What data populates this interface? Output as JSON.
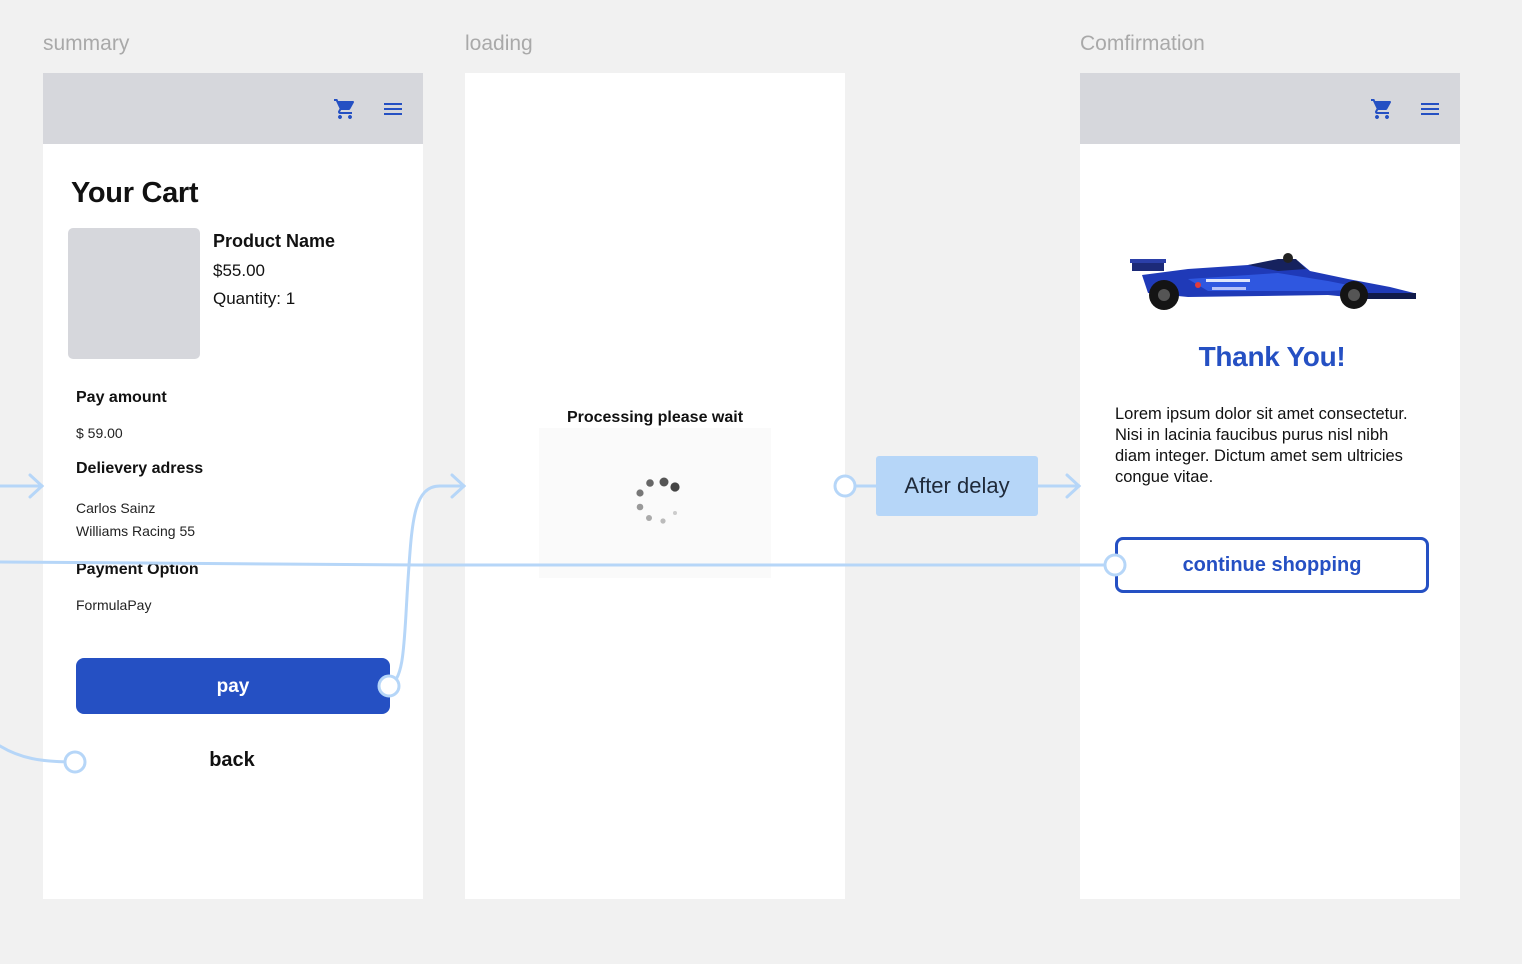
{
  "frames": {
    "summary_label": "summary",
    "loading_label": "loading",
    "confirmation_label": "Comfirmation"
  },
  "summary": {
    "title": "Your Cart",
    "product": {
      "name": "Product Name",
      "price": "$55.00",
      "quantity": "Quantity: 1"
    },
    "pay_amount_heading": "Pay amount",
    "pay_amount_value": "$ 59.00",
    "delivery_heading": "Delievery adress",
    "delivery_line1": "Carlos Sainz",
    "delivery_line2": "Williams Racing 55",
    "payment_heading": "Payment Option",
    "payment_value": "FormulaPay",
    "pay_button": "pay",
    "back_button": "back"
  },
  "loading": {
    "message": "Processing please wait"
  },
  "flow": {
    "delay_label": "After delay"
  },
  "confirmation": {
    "heading": "Thank You!",
    "body": "Lorem ipsum dolor sit amet consectetur. Nisi in lacinia faucibus purus nisl nibh diam integer. Dictum amet sem ultricies congue vitae.",
    "continue_button": "continue shopping"
  },
  "icons": {
    "cart": "shopping-cart-icon",
    "menu": "hamburger-menu-icon",
    "spinner": "loading-spinner-icon"
  },
  "colors": {
    "accent": "#2550c3",
    "connector": "#b6d6f8",
    "topbar": "#d6d7dc",
    "canvas": "#f1f1f1"
  }
}
